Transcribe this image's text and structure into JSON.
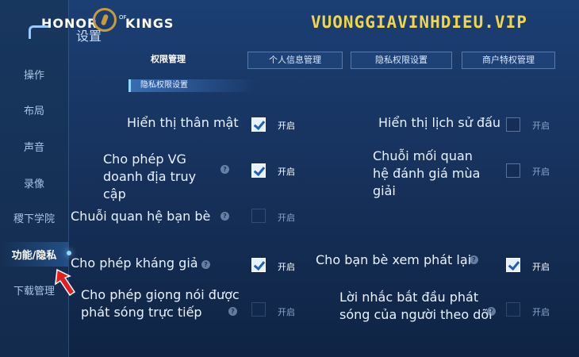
{
  "brand": {
    "left": "HONOR",
    "of": "OF",
    "right": "KINGS"
  },
  "watermark": "VUONGGIAVINHDIEU.VIP",
  "page_title": "设置",
  "sidebar": {
    "items": [
      {
        "label": "操作"
      },
      {
        "label": "布局"
      },
      {
        "label": "声音"
      },
      {
        "label": "录像"
      },
      {
        "label": "稷下学院"
      },
      {
        "label": "功能/隐私",
        "active": true
      },
      {
        "label": "下载管理"
      }
    ]
  },
  "tabs": [
    {
      "label": "权限管理",
      "active": true
    },
    {
      "label": "个人信息管理"
    },
    {
      "label": "隐私权限设置"
    },
    {
      "label": "商户特权管理"
    }
  ],
  "section_title": "隐私权限设置",
  "settings": [
    {
      "label": "Hiển thị thân mật",
      "checked": true,
      "state": "开启"
    },
    {
      "label": "Hiển thị lịch sử đấu",
      "checked": false,
      "state": "开启"
    },
    {
      "label": "Cho phép VG doanh địa truy cập",
      "checked": true,
      "state": "开启",
      "help": "?"
    },
    {
      "label": "Chuỗi mối quan hệ đánh giá mùa giải",
      "checked": false,
      "state": "开启"
    },
    {
      "label": "Chuỗi quan hệ bạn bè",
      "checked": false,
      "state": "开启",
      "help": "?"
    },
    {
      "label": "Cho phép kháng giả",
      "checked": true,
      "state": "开启",
      "help": "?"
    },
    {
      "label": "Cho bạn bè xem phát lại",
      "checked": true,
      "state": "开启",
      "help": "?"
    },
    {
      "label": "Cho phép giọng nói được phát sóng trực tiếp",
      "checked": false,
      "state": "开启",
      "help": "?"
    },
    {
      "label": "Lời nhắc bắt đầu phát sóng của người theo dõi",
      "checked": false,
      "state": "开启",
      "help": "?"
    }
  ],
  "colors": {
    "accent": "#8fd6ff",
    "watermark": "#f0d64c",
    "checked": "#e8f2ff",
    "annotation_arrow": "#e02020"
  }
}
